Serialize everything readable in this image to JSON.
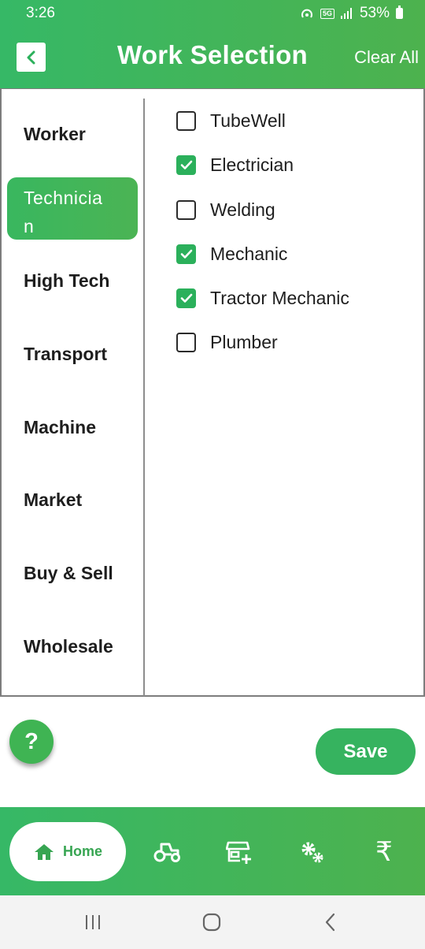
{
  "status": {
    "time": "3:26",
    "network": "5G",
    "battery": "53%"
  },
  "header": {
    "title": "Work Selection",
    "clear_all": "Clear All"
  },
  "categories": [
    {
      "label": "Worker",
      "active": false
    },
    {
      "label": "Technician",
      "display": "Technicia\nn",
      "active": true
    },
    {
      "label": "High Tech",
      "active": false
    },
    {
      "label": "Transport",
      "active": false
    },
    {
      "label": "Machine",
      "active": false
    },
    {
      "label": "Market",
      "active": false
    },
    {
      "label": "Buy & Sell",
      "active": false
    },
    {
      "label": "Wholesale",
      "active": false
    }
  ],
  "options": [
    {
      "label": "TubeWell",
      "checked": false
    },
    {
      "label": "Electrician",
      "checked": true
    },
    {
      "label": "Welding",
      "checked": false
    },
    {
      "label": "Mechanic",
      "checked": true
    },
    {
      "label": "Tractor Mechanic",
      "checked": true
    },
    {
      "label": "Plumber",
      "checked": false
    }
  ],
  "help_button": "?",
  "save_button": "Save",
  "bottom_nav": {
    "home_label": "Home",
    "icons": [
      "tractor-icon",
      "store-add-icon",
      "gears-icon",
      "rupee-icon"
    ],
    "rupee_glyph": "₹"
  },
  "colors": {
    "accent": "#3fb454",
    "accent_dark": "#2bb05b"
  }
}
